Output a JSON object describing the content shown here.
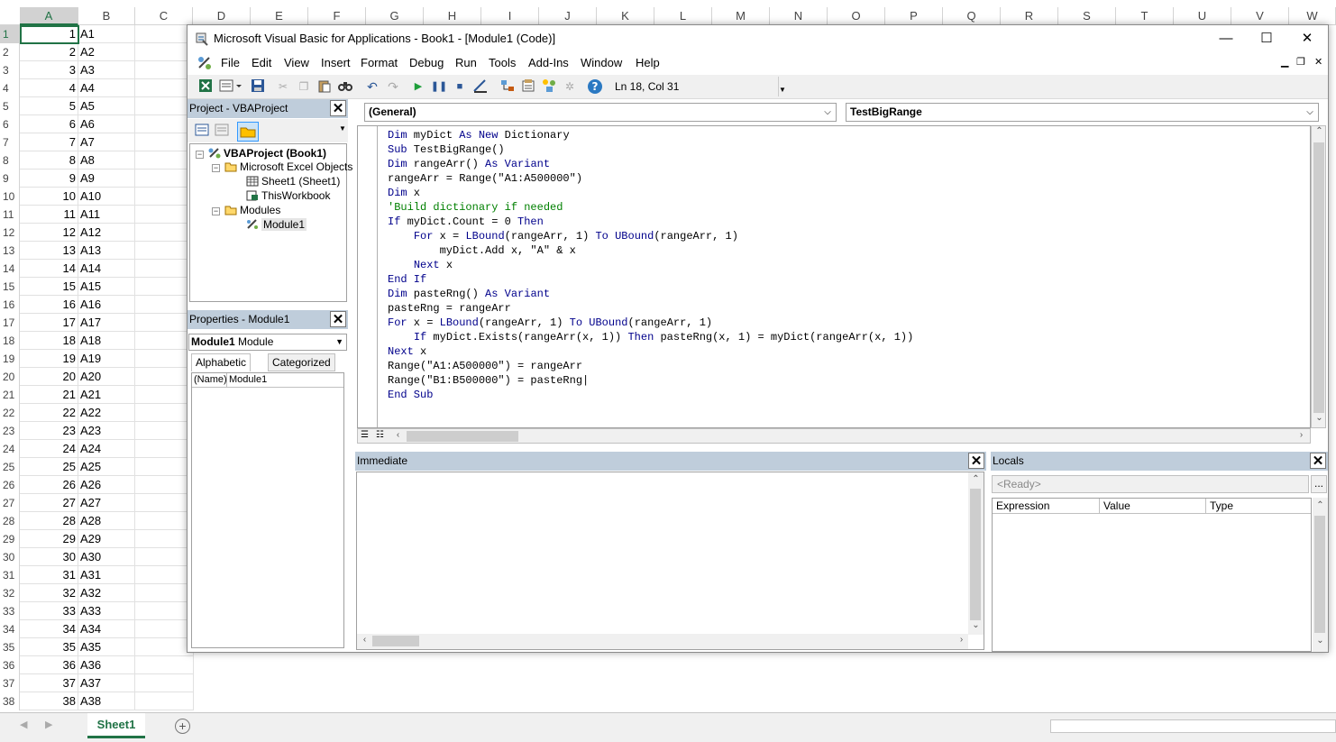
{
  "excel": {
    "columns": [
      "A",
      "B",
      "C",
      "D",
      "E",
      "F",
      "G",
      "H",
      "I",
      "J",
      "K",
      "L",
      "M",
      "N",
      "O",
      "P",
      "Q",
      "R",
      "S",
      "T",
      "U",
      "V",
      "W"
    ],
    "rows": [
      {
        "n": "1",
        "a": "1",
        "b": "A1"
      },
      {
        "n": "2",
        "a": "2",
        "b": "A2"
      },
      {
        "n": "3",
        "a": "3",
        "b": "A3"
      },
      {
        "n": "4",
        "a": "4",
        "b": "A4"
      },
      {
        "n": "5",
        "a": "5",
        "b": "A5"
      },
      {
        "n": "6",
        "a": "6",
        "b": "A6"
      },
      {
        "n": "7",
        "a": "7",
        "b": "A7"
      },
      {
        "n": "8",
        "a": "8",
        "b": "A8"
      },
      {
        "n": "9",
        "a": "9",
        "b": "A9"
      },
      {
        "n": "10",
        "a": "10",
        "b": "A10"
      },
      {
        "n": "11",
        "a": "11",
        "b": "A11"
      },
      {
        "n": "12",
        "a": "12",
        "b": "A12"
      },
      {
        "n": "13",
        "a": "13",
        "b": "A13"
      },
      {
        "n": "14",
        "a": "14",
        "b": "A14"
      },
      {
        "n": "15",
        "a": "15",
        "b": "A15"
      },
      {
        "n": "16",
        "a": "16",
        "b": "A16"
      },
      {
        "n": "17",
        "a": "17",
        "b": "A17"
      },
      {
        "n": "18",
        "a": "18",
        "b": "A18"
      },
      {
        "n": "19",
        "a": "19",
        "b": "A19"
      },
      {
        "n": "20",
        "a": "20",
        "b": "A20"
      },
      {
        "n": "21",
        "a": "21",
        "b": "A21"
      },
      {
        "n": "22",
        "a": "22",
        "b": "A22"
      },
      {
        "n": "23",
        "a": "23",
        "b": "A23"
      },
      {
        "n": "24",
        "a": "24",
        "b": "A24"
      },
      {
        "n": "25",
        "a": "25",
        "b": "A25"
      },
      {
        "n": "26",
        "a": "26",
        "b": "A26"
      },
      {
        "n": "27",
        "a": "27",
        "b": "A27"
      },
      {
        "n": "28",
        "a": "28",
        "b": "A28"
      },
      {
        "n": "29",
        "a": "29",
        "b": "A29"
      },
      {
        "n": "30",
        "a": "30",
        "b": "A30"
      },
      {
        "n": "31",
        "a": "31",
        "b": "A31"
      },
      {
        "n": "32",
        "a": "32",
        "b": "A32"
      },
      {
        "n": "33",
        "a": "33",
        "b": "A33"
      },
      {
        "n": "34",
        "a": "34",
        "b": "A34"
      },
      {
        "n": "35",
        "a": "35",
        "b": "A35"
      },
      {
        "n": "36",
        "a": "36",
        "b": "A36"
      },
      {
        "n": "37",
        "a": "37",
        "b": "A37"
      },
      {
        "n": "38",
        "a": "38",
        "b": "A38"
      }
    ],
    "sheet_tab": "Sheet1",
    "add_sheet_symbol": "+"
  },
  "vbe": {
    "title": "Microsoft Visual Basic for Applications - Book1 - [Module1 (Code)]",
    "window_controls": {
      "minimize": "—",
      "maximize": "☐",
      "close": "✕"
    },
    "menu": [
      "File",
      "Edit",
      "View",
      "Insert",
      "Format",
      "Debug",
      "Run",
      "Tools",
      "Add-Ins",
      "Window",
      "Help"
    ],
    "mdi_controls": {
      "minimize": "▁",
      "restore": "❐",
      "close": "✕"
    },
    "cursor_position": "Ln 18, Col 31",
    "project": {
      "header": "Project - VBAProject",
      "tree": [
        "VBAProject (Book1)",
        "Microsoft Excel Objects",
        "Sheet1 (Sheet1)",
        "ThisWorkbook",
        "Modules",
        "Module1"
      ]
    },
    "properties": {
      "header": "Properties - Module1",
      "combo_name": "Module1",
      "combo_type": "Module",
      "tabs": [
        "Alphabetic",
        "Categorized"
      ],
      "row_key": "(Name)",
      "row_value": "Module1"
    },
    "code": {
      "object_combo": "(General)",
      "proc_combo": "TestBigRange",
      "lines": [
        [
          {
            "t": "Dim",
            "k": "kw"
          },
          {
            "t": " myDict "
          },
          {
            "t": "As New",
            "k": "kw"
          },
          {
            "t": " Dictionary"
          }
        ],
        [
          {
            "t": "Sub",
            "k": "kw"
          },
          {
            "t": " TestBigRange()"
          }
        ],
        [
          {
            "t": "Dim",
            "k": "kw"
          },
          {
            "t": " rangeArr() "
          },
          {
            "t": "As Variant",
            "k": "kw"
          }
        ],
        [
          {
            "t": "rangeArr = Range(\"A1:A500000\")"
          }
        ],
        [
          {
            "t": "Dim",
            "k": "kw"
          },
          {
            "t": " x"
          }
        ],
        [
          {
            "t": "'Build dictionary if needed",
            "k": "cm"
          }
        ],
        [
          {
            "t": "If",
            "k": "kw"
          },
          {
            "t": " myDict.Count = 0 "
          },
          {
            "t": "Then",
            "k": "kw"
          }
        ],
        [
          {
            "t": "    "
          },
          {
            "t": "For",
            "k": "kw"
          },
          {
            "t": " x = "
          },
          {
            "t": "LBound",
            "k": "kw"
          },
          {
            "t": "(rangeArr, 1) "
          },
          {
            "t": "To",
            "k": "kw"
          },
          {
            "t": " "
          },
          {
            "t": "UBound",
            "k": "kw"
          },
          {
            "t": "(rangeArr, 1)"
          }
        ],
        [
          {
            "t": "        myDict.Add x, \"A\" & x"
          }
        ],
        [
          {
            "t": "    "
          },
          {
            "t": "Next",
            "k": "kw"
          },
          {
            "t": " x"
          }
        ],
        [
          {
            "t": "End If",
            "k": "kw"
          }
        ],
        [
          {
            "t": "Dim",
            "k": "kw"
          },
          {
            "t": " pasteRng() "
          },
          {
            "t": "As Variant",
            "k": "kw"
          }
        ],
        [
          {
            "t": "pasteRng = rangeArr"
          }
        ],
        [
          {
            "t": "For",
            "k": "kw"
          },
          {
            "t": " x = "
          },
          {
            "t": "LBound",
            "k": "kw"
          },
          {
            "t": "(rangeArr, 1) "
          },
          {
            "t": "To",
            "k": "kw"
          },
          {
            "t": " "
          },
          {
            "t": "UBound",
            "k": "kw"
          },
          {
            "t": "(rangeArr, 1)"
          }
        ],
        [
          {
            "t": "    "
          },
          {
            "t": "If",
            "k": "kw"
          },
          {
            "t": " myDict.Exists(rangeArr(x, 1)) "
          },
          {
            "t": "Then",
            "k": "kw"
          },
          {
            "t": " pasteRng(x, 1) = myDict(rangeArr(x, 1))"
          }
        ],
        [
          {
            "t": "Next",
            "k": "kw"
          },
          {
            "t": " x"
          }
        ],
        [
          {
            "t": "Range(\"A1:A500000\") = rangeArr"
          }
        ],
        [
          {
            "t": "Range(\"B1:B500000\") = pasteRng|"
          }
        ],
        [
          {
            "t": "End Sub",
            "k": "kw"
          }
        ]
      ]
    },
    "immediate": {
      "header": "Immediate"
    },
    "locals": {
      "header": "Locals",
      "status": "<Ready>",
      "browse": "...",
      "columns": [
        "Expression",
        "Value",
        "Type"
      ]
    }
  }
}
